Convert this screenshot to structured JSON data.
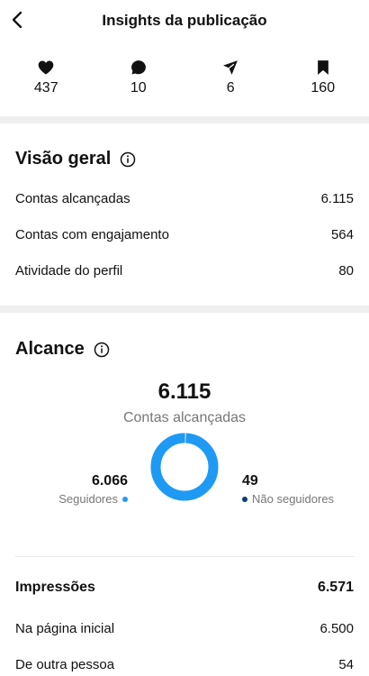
{
  "header": {
    "title": "Insights da publicação"
  },
  "stats": [
    {
      "icon": "heart-icon",
      "value": "437"
    },
    {
      "icon": "comment-icon",
      "value": "10"
    },
    {
      "icon": "share-icon",
      "value": "6"
    },
    {
      "icon": "bookmark-icon",
      "value": "160"
    }
  ],
  "overview": {
    "title": "Visão geral",
    "rows": [
      {
        "label": "Contas alcançadas",
        "value": "6.115"
      },
      {
        "label": "Contas com engajamento",
        "value": "564"
      },
      {
        "label": "Atividade do perfil",
        "value": "80"
      }
    ]
  },
  "reach": {
    "title": "Alcance",
    "total": "6.115",
    "total_label": "Contas alcançadas",
    "followers": {
      "value": "6.066",
      "label": "Seguidores",
      "color": "#1e9af5",
      "count": 6066
    },
    "non_followers": {
      "value": "49",
      "label": "Não seguidores",
      "color": "#0d3a7a",
      "count": 49
    },
    "ring_background": "#cfd8e0"
  },
  "impressions": {
    "title": "Impressões",
    "total": "6.571",
    "rows": [
      {
        "label": "Na página inicial",
        "value": "6.500"
      },
      {
        "label": "De outra pessoa",
        "value": "54"
      }
    ]
  }
}
